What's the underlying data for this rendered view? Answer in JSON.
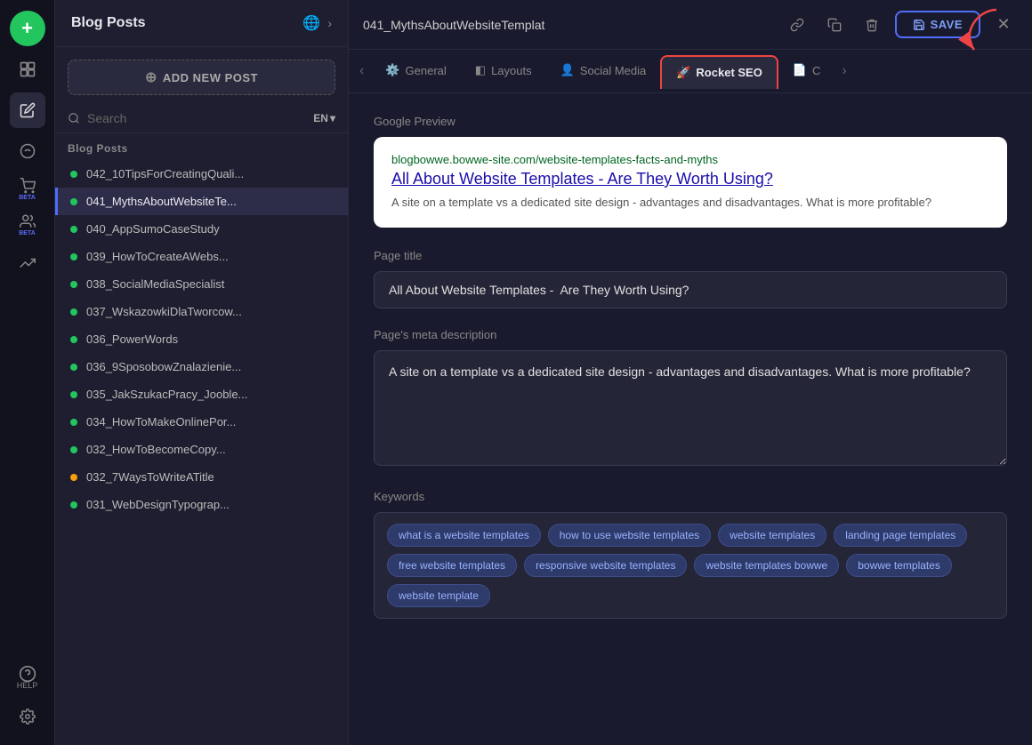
{
  "iconBar": {
    "addLabel": "+",
    "icons": [
      {
        "name": "pages-icon",
        "symbol": "⬜",
        "active": false
      },
      {
        "name": "edit-icon",
        "symbol": "✏️",
        "active": true
      },
      {
        "name": "design-icon",
        "symbol": "🖌️",
        "active": false
      },
      {
        "name": "cart-icon",
        "symbol": "🛒",
        "active": false,
        "badge": "BETA"
      },
      {
        "name": "crm-icon",
        "symbol": "👥",
        "active": false,
        "badge": "BETA"
      },
      {
        "name": "analytics-icon",
        "symbol": "📈",
        "active": false
      }
    ],
    "helpLabel": "HELP"
  },
  "sidebar": {
    "title": "Blog Posts",
    "addButton": "ADD NEW POST",
    "searchPlaceholder": "Search",
    "lang": "EN",
    "sectionLabel": "Blog Posts",
    "posts": [
      {
        "id": "042",
        "name": "042_10TipsForCreatingQuali...",
        "dotColor": "green",
        "active": false
      },
      {
        "id": "041",
        "name": "041_MythsAboutWebsiteTe...",
        "dotColor": "green",
        "active": true
      },
      {
        "id": "040",
        "name": "040_AppSumoCaseStudy",
        "dotColor": "green",
        "active": false
      },
      {
        "id": "039",
        "name": "039_HowToCreateAWebs...",
        "dotColor": "green",
        "active": false
      },
      {
        "id": "038",
        "name": "038_SocialMediaSpecialist",
        "dotColor": "green",
        "active": false
      },
      {
        "id": "037",
        "name": "037_WskazowkiDlaTworcow...",
        "dotColor": "green",
        "active": false
      },
      {
        "id": "036a",
        "name": "036_PowerWords",
        "dotColor": "green",
        "active": false
      },
      {
        "id": "036b",
        "name": "036_9SposobowZnalazieniе...",
        "dotColor": "green",
        "active": false
      },
      {
        "id": "035",
        "name": "035_JakSzukacPracy_Jooble...",
        "dotColor": "green",
        "active": false
      },
      {
        "id": "034",
        "name": "034_HowToMakeOnlinePor...",
        "dotColor": "green",
        "active": false
      },
      {
        "id": "032a",
        "name": "032_HowToBecomeCopy...",
        "dotColor": "green",
        "active": false
      },
      {
        "id": "032b",
        "name": "032_7WaysToWriteATitle",
        "dotColor": "yellow",
        "active": false
      },
      {
        "id": "031",
        "name": "031_WebDesignTypograp...",
        "dotColor": "green",
        "active": false
      }
    ]
  },
  "topbar": {
    "title": "041_MythsAboutWebsiteTemplat",
    "saveLabel": "SAVE"
  },
  "tabs": [
    {
      "id": "general",
      "label": "General",
      "icon": "⚙️"
    },
    {
      "id": "layouts",
      "label": "Layouts",
      "icon": "◧"
    },
    {
      "id": "social-media",
      "label": "Social Media",
      "icon": "👤"
    },
    {
      "id": "rocket-seo",
      "label": "Rocket SEO",
      "icon": "🚀",
      "active": true,
      "highlighted": true
    },
    {
      "id": "tab-c",
      "label": "C",
      "icon": "📄"
    }
  ],
  "content": {
    "googlePreviewLabel": "Google Preview",
    "googlePreview": {
      "url": "blogbowwe.bowwe-site.com/website-templates-facts-and-myths",
      "title": "All About Website Templates - Are They Worth Using?",
      "description": "A site on a template vs a dedicated site design - advantages and disadvantages. What is more profitable?"
    },
    "pageTitleLabel": "Page title",
    "pageTitle": "All About Website Templates -  Are They Worth Using?",
    "metaDescLabel": "Page's meta description",
    "metaDesc": "A site on a template vs a dedicated site design - advantages and disadvantages. What is more profitable?",
    "keywordsLabel": "Keywords",
    "keywords": [
      "what is a website templates",
      "how to use website templates",
      "website templates",
      "landing page templates",
      "free website templates",
      "responsive website templates",
      "website templates bowwe",
      "bowwe templates",
      "website template"
    ]
  }
}
